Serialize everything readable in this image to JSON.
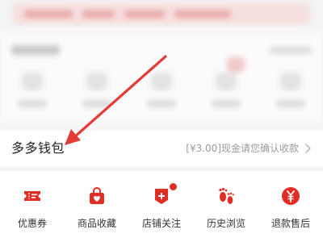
{
  "wallet": {
    "title": "多多钱包",
    "subtitle": "[¥3.00]现金请您确认收款"
  },
  "actions": [
    {
      "label": "优惠券",
      "icon": "coupon-icon"
    },
    {
      "label": "商品收藏",
      "icon": "shopping-bag-icon"
    },
    {
      "label": "店铺关注",
      "icon": "store-follow-icon"
    },
    {
      "label": "历史浏览",
      "icon": "footprints-icon"
    },
    {
      "label": "退款售后",
      "icon": "refund-yen-icon"
    }
  ],
  "colors": {
    "accent": "#e02e24",
    "annotation_arrow": "#e33b36",
    "text_primary": "#222222",
    "text_secondary": "#9a9a9a",
    "background": "#f5f5f5"
  }
}
